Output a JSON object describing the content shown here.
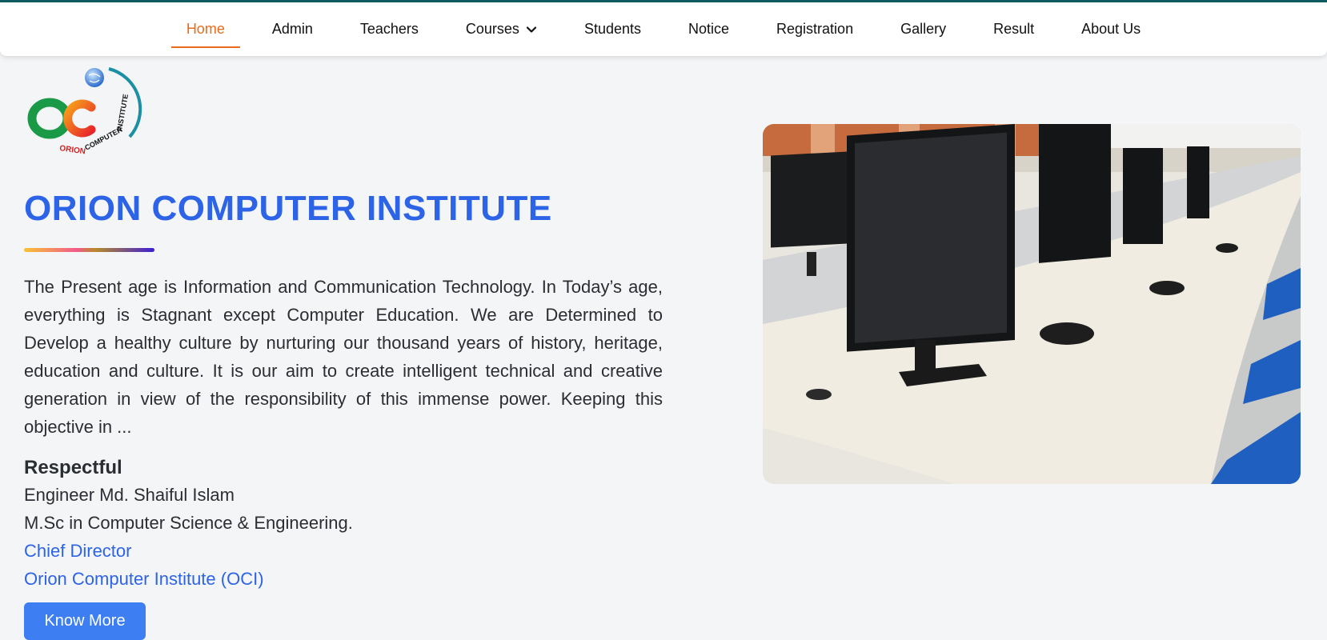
{
  "nav": {
    "items": [
      {
        "label": "Home",
        "active": true
      },
      {
        "label": "Admin"
      },
      {
        "label": "Teachers"
      },
      {
        "label": "Courses"
      },
      {
        "label": "Students"
      },
      {
        "label": "Notice"
      },
      {
        "label": "Registration"
      },
      {
        "label": "Gallery"
      },
      {
        "label": "Result"
      },
      {
        "label": "About Us"
      }
    ]
  },
  "logo": {
    "text": "OCi",
    "ring_text": "ORION COMPUTER INSTITUTE"
  },
  "hero": {
    "title": "ORION COMPUTER INSTITUTE",
    "paragraph": "The Present age is Information and Communication Technology. In Today’s age, everything is Stagnant except Computer Education. We are Determined to Develop a healthy culture by nurturing our thousand years of history, heritage, education and culture. It is our aim to create intelligent technical and creative generation in view of the responsibility of this immense power. Keeping this objective in ...",
    "respectful_heading": "Respectful",
    "name": "Engineer Md. Shaiful Islam",
    "degree": "M.Sc in Computer Science & Engineering.",
    "position": "Chief Director",
    "institute": "Orion Computer Institute (OCI)",
    "button_label": "Know More"
  },
  "colors": {
    "accent": "#2d63e6",
    "active_nav": "#ea6a1c",
    "button": "#3d7ef3",
    "top_border": "#0f5b63"
  }
}
